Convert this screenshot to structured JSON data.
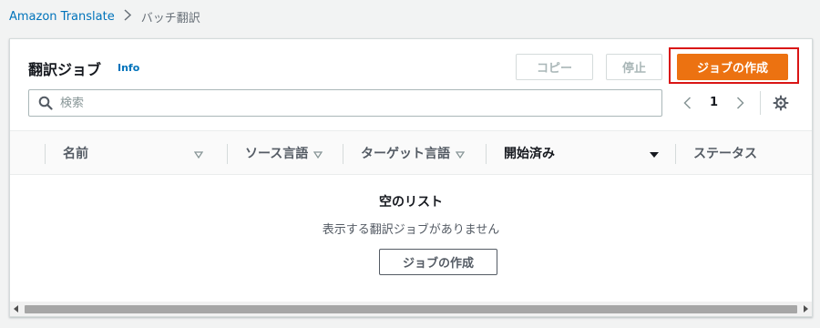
{
  "breadcrumb": {
    "service": "Amazon Translate",
    "current": "バッチ翻訳"
  },
  "panel": {
    "title": "翻訳ジョブ",
    "info_label": "Info"
  },
  "toolbar": {
    "copy_label": "コピー",
    "stop_label": "停止",
    "create_label": "ジョブの作成"
  },
  "search": {
    "placeholder": "検索",
    "value": ""
  },
  "pagination": {
    "current_page": "1"
  },
  "table": {
    "columns": [
      {
        "label": "名前",
        "sort": "unsorted"
      },
      {
        "label": "ソース言語",
        "sort": "unsorted"
      },
      {
        "label": "ターゲット言語",
        "sort": "unsorted"
      },
      {
        "label": "開始済み",
        "sort": "descending"
      },
      {
        "label": "ステータス",
        "sort": "none"
      }
    ],
    "rows": []
  },
  "empty_state": {
    "title": "空のリスト",
    "message": "表示する翻訳ジョブがありません",
    "button_label": "ジョブの作成"
  },
  "colors": {
    "accent": "#ec7211",
    "highlight": "#d91515",
    "link": "#0073bb"
  }
}
